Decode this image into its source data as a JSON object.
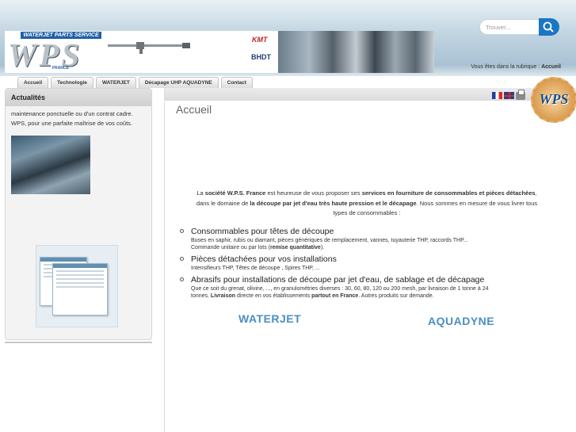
{
  "header": {
    "search": {
      "placeholder": "Trouver..."
    },
    "banner": {
      "tagline": "WATERJET PARTS SERVICE",
      "logo": "WPS",
      "country": "FRANCE",
      "brand_kmt": "KMT",
      "brand_bhdt": "BHDT"
    },
    "breadcrumb": {
      "prefix": "Vous êtes dans la rubrique :",
      "current": "Accueil"
    }
  },
  "nav": {
    "tabs": [
      {
        "label": "Accueil"
      },
      {
        "label": "Technologie"
      },
      {
        "label": "WATERJET"
      },
      {
        "label": "Décapage UHP AQUADYNE"
      },
      {
        "label": "Contact"
      }
    ]
  },
  "sidebar": {
    "title": "Actualités",
    "text_line1": "maintenance ponctuelle ou d'un contrat cadre.",
    "text_line2": "WPS, pour une parfaite maîtrise de vos coûts."
  },
  "content": {
    "title": "Accueil",
    "seal_text": "WPS",
    "intro": {
      "p1_a": "La",
      "p1_company": "société W.P.S. France",
      "p1_b": "est heureuse de vous proposer ses",
      "p1_services": "services en fourniture de consommables et pièces détachées",
      "p1_c": ",",
      "p2_a": "dans le domaine de",
      "p2_domain": "la découpe par jet d'eau très haute pression et le décapage",
      "p2_b": ". Nous sommes en mesure de vous livrer tous",
      "p3": "types de consommables :"
    },
    "features": [
      {
        "title": "Consommables pour têtes de découpe",
        "desc1": "Buses en saphir, rubis ou diamant, pièces génériques de remplacement, vannes, tuyauterie THP, raccords THP...",
        "desc2_a": "Commande unitaire ou par lots (",
        "desc2_bold": "remise quantitative",
        "desc2_b": ")."
      },
      {
        "title": "Pièces détachées pour vos installations",
        "desc1": "Intensifieurs THP, Têtes de découpe , Spires THP, ..."
      },
      {
        "title": "Abrasifs pour installations de découpe par jet d'eau, de sablage et de décapage",
        "desc1": "Que ce soit du grenat, olivine, ..., en granulométries diverses : 30, 60, 80, 120 ou 200 mesh, par livraison de 1 tonne à 24",
        "desc2_a": "tonnes.",
        "desc2_bold": "Livraison",
        "desc2_b": "directe en vos établissements",
        "desc2_bold2": "partout en France",
        "desc2_c": ". Autres produits sur demande."
      }
    ],
    "brands": {
      "waterjet": "WATERJET",
      "aquadyne": "AQUADYNE"
    }
  },
  "colors": {
    "accent_blue": "#1b76c4",
    "brand_text_blue": "#4a8ec2",
    "header_band": "#a9c2d3"
  }
}
